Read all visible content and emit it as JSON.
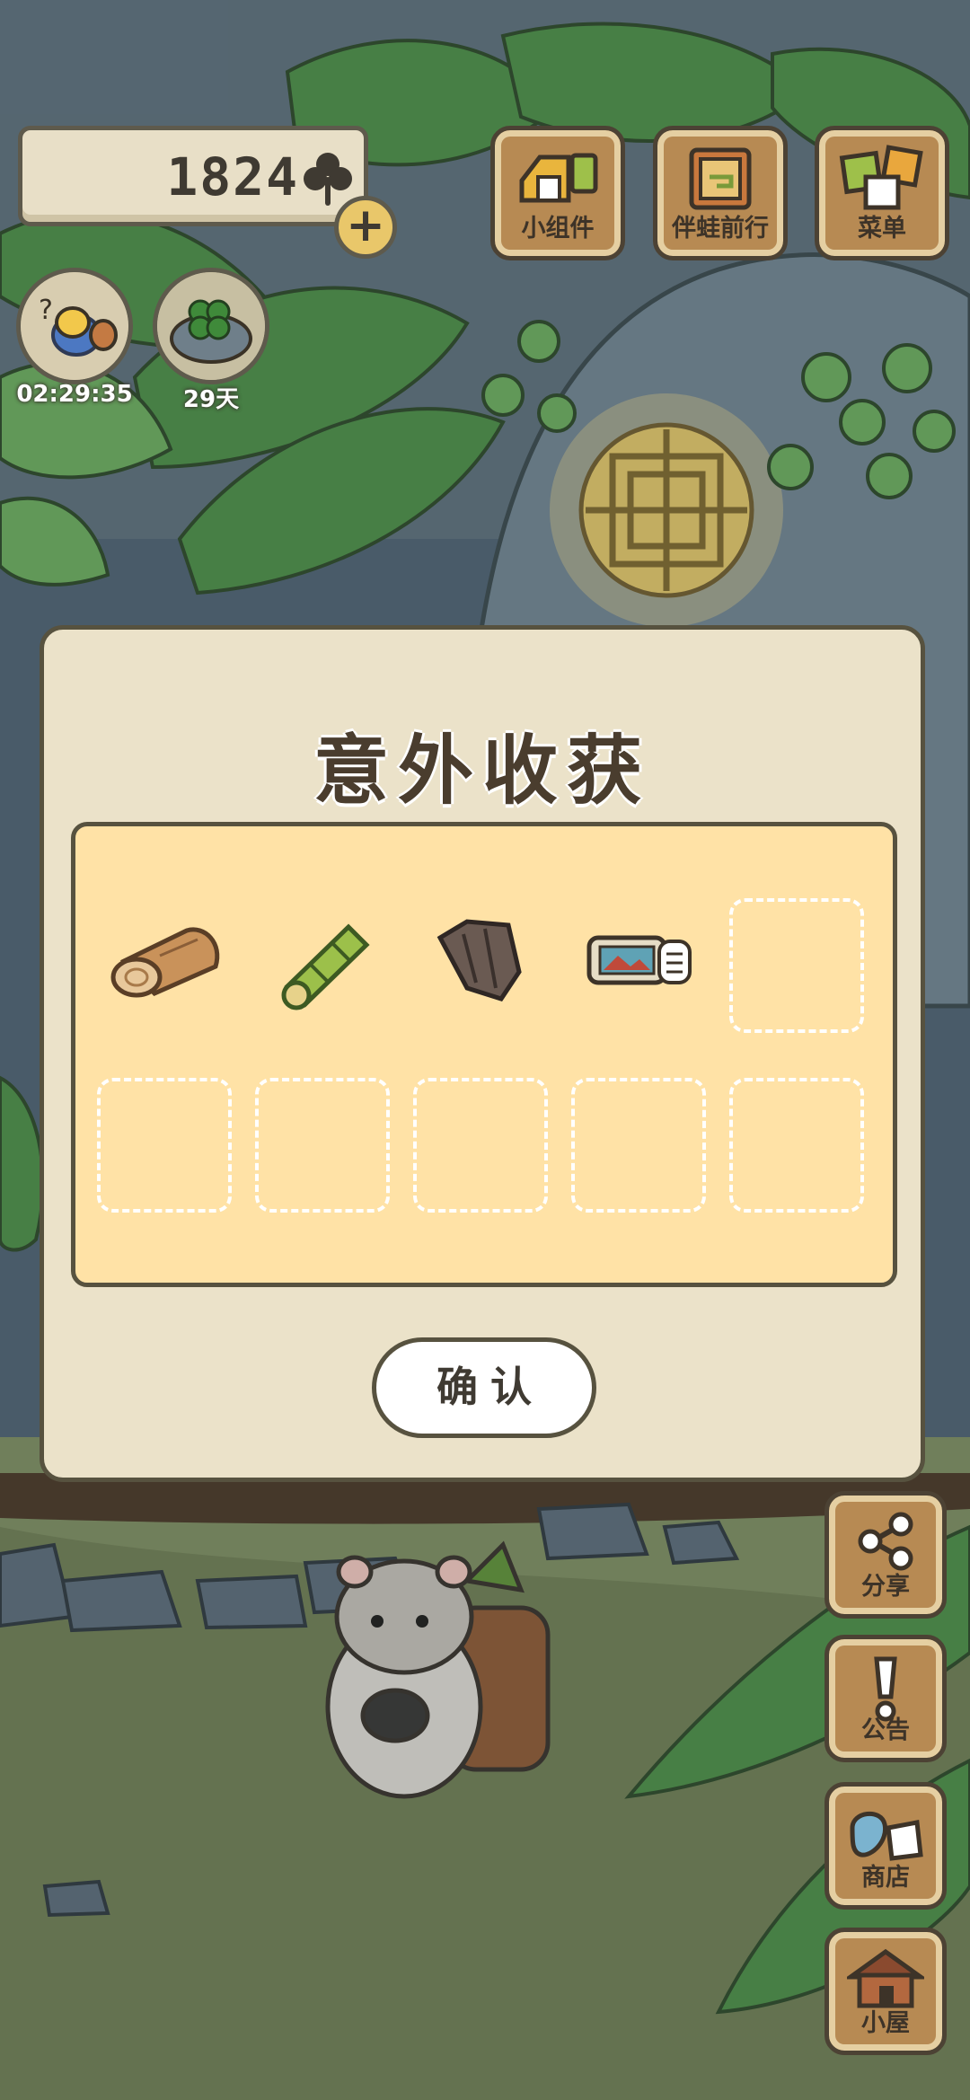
{
  "currency": {
    "value": "1824",
    "icon": "clover-icon"
  },
  "status_icons": [
    {
      "name": "frog-travel-timer",
      "label": "02:29:35"
    },
    {
      "name": "clover-garden",
      "label": "29天"
    }
  ],
  "top_menu": [
    {
      "label": "小组件",
      "icon": "widget-icon"
    },
    {
      "label": "伴蛙前行",
      "icon": "map-book-icon"
    },
    {
      "label": "菜单",
      "icon": "menu-cards-icon"
    }
  ],
  "side_menu": [
    {
      "label": "分享",
      "icon": "share-icon"
    },
    {
      "label": "公告",
      "icon": "exclamation-icon"
    },
    {
      "label": "商店",
      "icon": "shop-bags-icon"
    },
    {
      "label": "小屋",
      "icon": "house-icon"
    }
  ],
  "dialog": {
    "title": "意外收获",
    "items": [
      "wood-log-icon",
      "bamboo-icon",
      "bark-icon",
      "ticket-icon"
    ],
    "empty_slots": 6,
    "confirm_label": "确认"
  },
  "colors": {
    "dialog_bg": "#ebe2c9",
    "grid_bg": "#ffe2a6",
    "wood_button": "#b78a53",
    "outline": "#57523f"
  }
}
